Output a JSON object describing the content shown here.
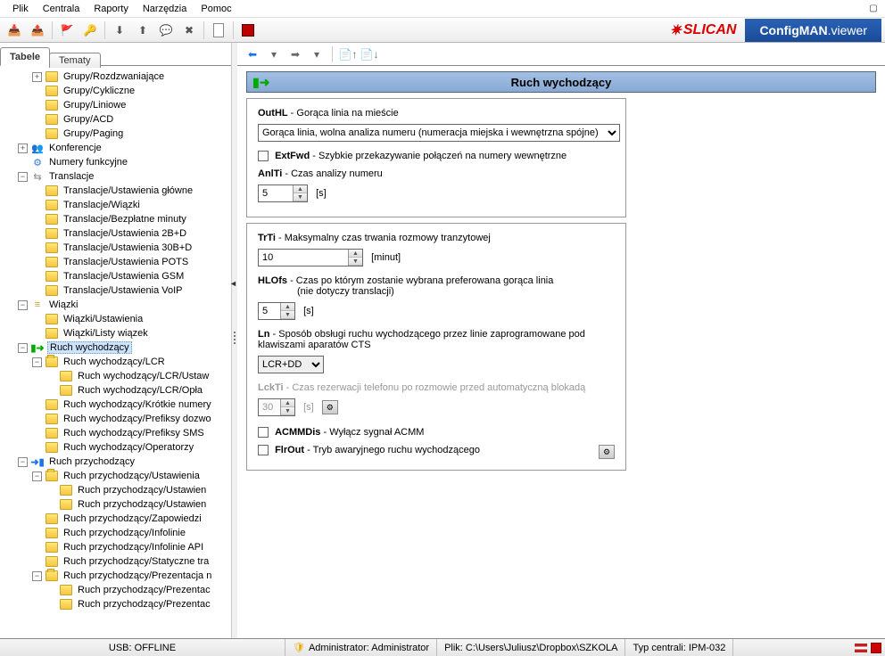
{
  "menu": [
    "Plik",
    "Centrala",
    "Raporty",
    "Narzędzia",
    "Pomoc"
  ],
  "brand": {
    "logo": "SLICAN",
    "app": "ConfigMAN",
    "suffix": ".viewer"
  },
  "tabs": {
    "tab1": "Tabele",
    "tab2": "Tematy"
  },
  "tree": [
    {
      "ind": 2,
      "tog": "+",
      "icon": "folder",
      "label": "Grupy/Rozdzwaniające"
    },
    {
      "ind": 2,
      "tog": "",
      "icon": "folder",
      "label": "Grupy/Cykliczne"
    },
    {
      "ind": 2,
      "tog": "",
      "icon": "folder",
      "label": "Grupy/Liniowe"
    },
    {
      "ind": 2,
      "tog": "",
      "icon": "folder",
      "label": "Grupy/ACD"
    },
    {
      "ind": 2,
      "tog": "",
      "icon": "folder",
      "label": "Grupy/Paging"
    },
    {
      "ind": 1,
      "tog": "+",
      "icon": "konf",
      "label": "Konferencje"
    },
    {
      "ind": 1,
      "tog": "",
      "icon": "num",
      "label": "Numery funkcyjne"
    },
    {
      "ind": 1,
      "tog": "−",
      "icon": "trans",
      "label": "Translacje"
    },
    {
      "ind": 2,
      "tog": "",
      "icon": "folder",
      "label": "Translacje/Ustawienia główne"
    },
    {
      "ind": 2,
      "tog": "",
      "icon": "folder",
      "label": "Translacje/Wiązki"
    },
    {
      "ind": 2,
      "tog": "",
      "icon": "folder",
      "label": "Translacje/Bezpłatne minuty"
    },
    {
      "ind": 2,
      "tog": "",
      "icon": "folder",
      "label": "Translacje/Ustawienia 2B+D"
    },
    {
      "ind": 2,
      "tog": "",
      "icon": "folder",
      "label": "Translacje/Ustawienia 30B+D"
    },
    {
      "ind": 2,
      "tog": "",
      "icon": "folder",
      "label": "Translacje/Ustawienia POTS"
    },
    {
      "ind": 2,
      "tog": "",
      "icon": "folder",
      "label": "Translacje/Ustawienia GSM"
    },
    {
      "ind": 2,
      "tog": "",
      "icon": "folder",
      "label": "Translacje/Ustawienia VoIP"
    },
    {
      "ind": 1,
      "tog": "−",
      "icon": "wiazki",
      "label": "Wiązki"
    },
    {
      "ind": 2,
      "tog": "",
      "icon": "folder",
      "label": "Wiązki/Ustawienia"
    },
    {
      "ind": 2,
      "tog": "",
      "icon": "folder",
      "label": "Wiązki/Listy wiązek"
    },
    {
      "ind": 1,
      "tog": "−",
      "icon": "out",
      "label": "Ruch wychodzący",
      "selected": true
    },
    {
      "ind": 2,
      "tog": "−",
      "icon": "folder-open",
      "label": "Ruch wychodzący/LCR"
    },
    {
      "ind": 3,
      "tog": "",
      "icon": "folder",
      "label": "Ruch wychodzący/LCR/Ustaw"
    },
    {
      "ind": 3,
      "tog": "",
      "icon": "folder",
      "label": "Ruch wychodzący/LCR/Opła"
    },
    {
      "ind": 2,
      "tog": "",
      "icon": "folder",
      "label": "Ruch wychodzący/Krótkie numery"
    },
    {
      "ind": 2,
      "tog": "",
      "icon": "folder",
      "label": "Ruch wychodzący/Prefiksy dozwo"
    },
    {
      "ind": 2,
      "tog": "",
      "icon": "folder",
      "label": "Ruch wychodzący/Prefiksy SMS"
    },
    {
      "ind": 2,
      "tog": "",
      "icon": "folder",
      "label": "Ruch wychodzący/Operatorzy"
    },
    {
      "ind": 1,
      "tog": "−",
      "icon": "in",
      "label": "Ruch przychodzący"
    },
    {
      "ind": 2,
      "tog": "−",
      "icon": "folder-open",
      "label": "Ruch przychodzący/Ustawienia"
    },
    {
      "ind": 3,
      "tog": "",
      "icon": "folder",
      "label": "Ruch przychodzący/Ustawien"
    },
    {
      "ind": 3,
      "tog": "",
      "icon": "folder",
      "label": "Ruch przychodzący/Ustawien"
    },
    {
      "ind": 2,
      "tog": "",
      "icon": "folder",
      "label": "Ruch przychodzący/Zapowiedzi"
    },
    {
      "ind": 2,
      "tog": "",
      "icon": "folder",
      "label": "Ruch przychodzący/Infolinie"
    },
    {
      "ind": 2,
      "tog": "",
      "icon": "folder",
      "label": "Ruch przychodzący/Infolinie API"
    },
    {
      "ind": 2,
      "tog": "",
      "icon": "folder",
      "label": "Ruch przychodzący/Statyczne tra"
    },
    {
      "ind": 2,
      "tog": "−",
      "icon": "folder-open",
      "label": "Ruch przychodzący/Prezentacja n"
    },
    {
      "ind": 3,
      "tog": "",
      "icon": "folder",
      "label": "Ruch przychodzący/Prezentac"
    },
    {
      "ind": 3,
      "tog": "",
      "icon": "folder",
      "label": "Ruch przychodzący/Prezentac"
    }
  ],
  "page": {
    "title": "Ruch wychodzący",
    "outhl_lbl": "OutHL",
    "outhl_desc": " - Gorąca linia na mieście",
    "outhl_value": "Gorąca linia, wolna analiza numeru (numeracja miejska i wewnętrzna spójne)",
    "extfwd_lbl": "ExtFwd",
    "extfwd_desc": " - Szybkie przekazywanie połączeń na numery wewnętrzne",
    "anlti_lbl": "AnlTi",
    "anlti_desc": " - Czas analizy numeru",
    "anlti_val": "5",
    "anlti_unit": "[s]",
    "trti_lbl": "TrTi",
    "trti_desc": " - Maksymalny czas trwania rozmowy tranzytowej",
    "trti_val": "10",
    "trti_unit": "[minut]",
    "hlofs_lbl": "HLOfs",
    "hlofs_desc": " - Czas po którym zostanie wybrana preferowana gorąca linia",
    "hlofs_desc2": "(nie dotyczy translacji)",
    "hlofs_val": "5",
    "hlofs_unit": "[s]",
    "ln_lbl": "Ln",
    "ln_desc": " - Sposób obsługi ruchu wychodzącego przez linie zaprogramowane pod klawiszami aparatów CTS",
    "ln_val": "LCR+DD",
    "lckti_lbl": "LckTi",
    "lckti_desc": " - Czas rezerwacji telefonu po rozmowie przed automatyczną blokadą",
    "lckti_val": "30",
    "lckti_unit": "[s]",
    "acmm_lbl": "ACMMDis",
    "acmm_desc": " - Wyłącz sygnał ACMM",
    "flrout_lbl": "FlrOut",
    "flrout_desc": " - Tryb awaryjnego ruchu wychodzącego"
  },
  "status": {
    "usb": "USB: OFFLINE",
    "admin": "Administrator: Administrator",
    "file": "Plik: C:\\Users\\Juliusz\\Dropbox\\SZKOLA",
    "type": "Typ centrali: IPM-032"
  }
}
